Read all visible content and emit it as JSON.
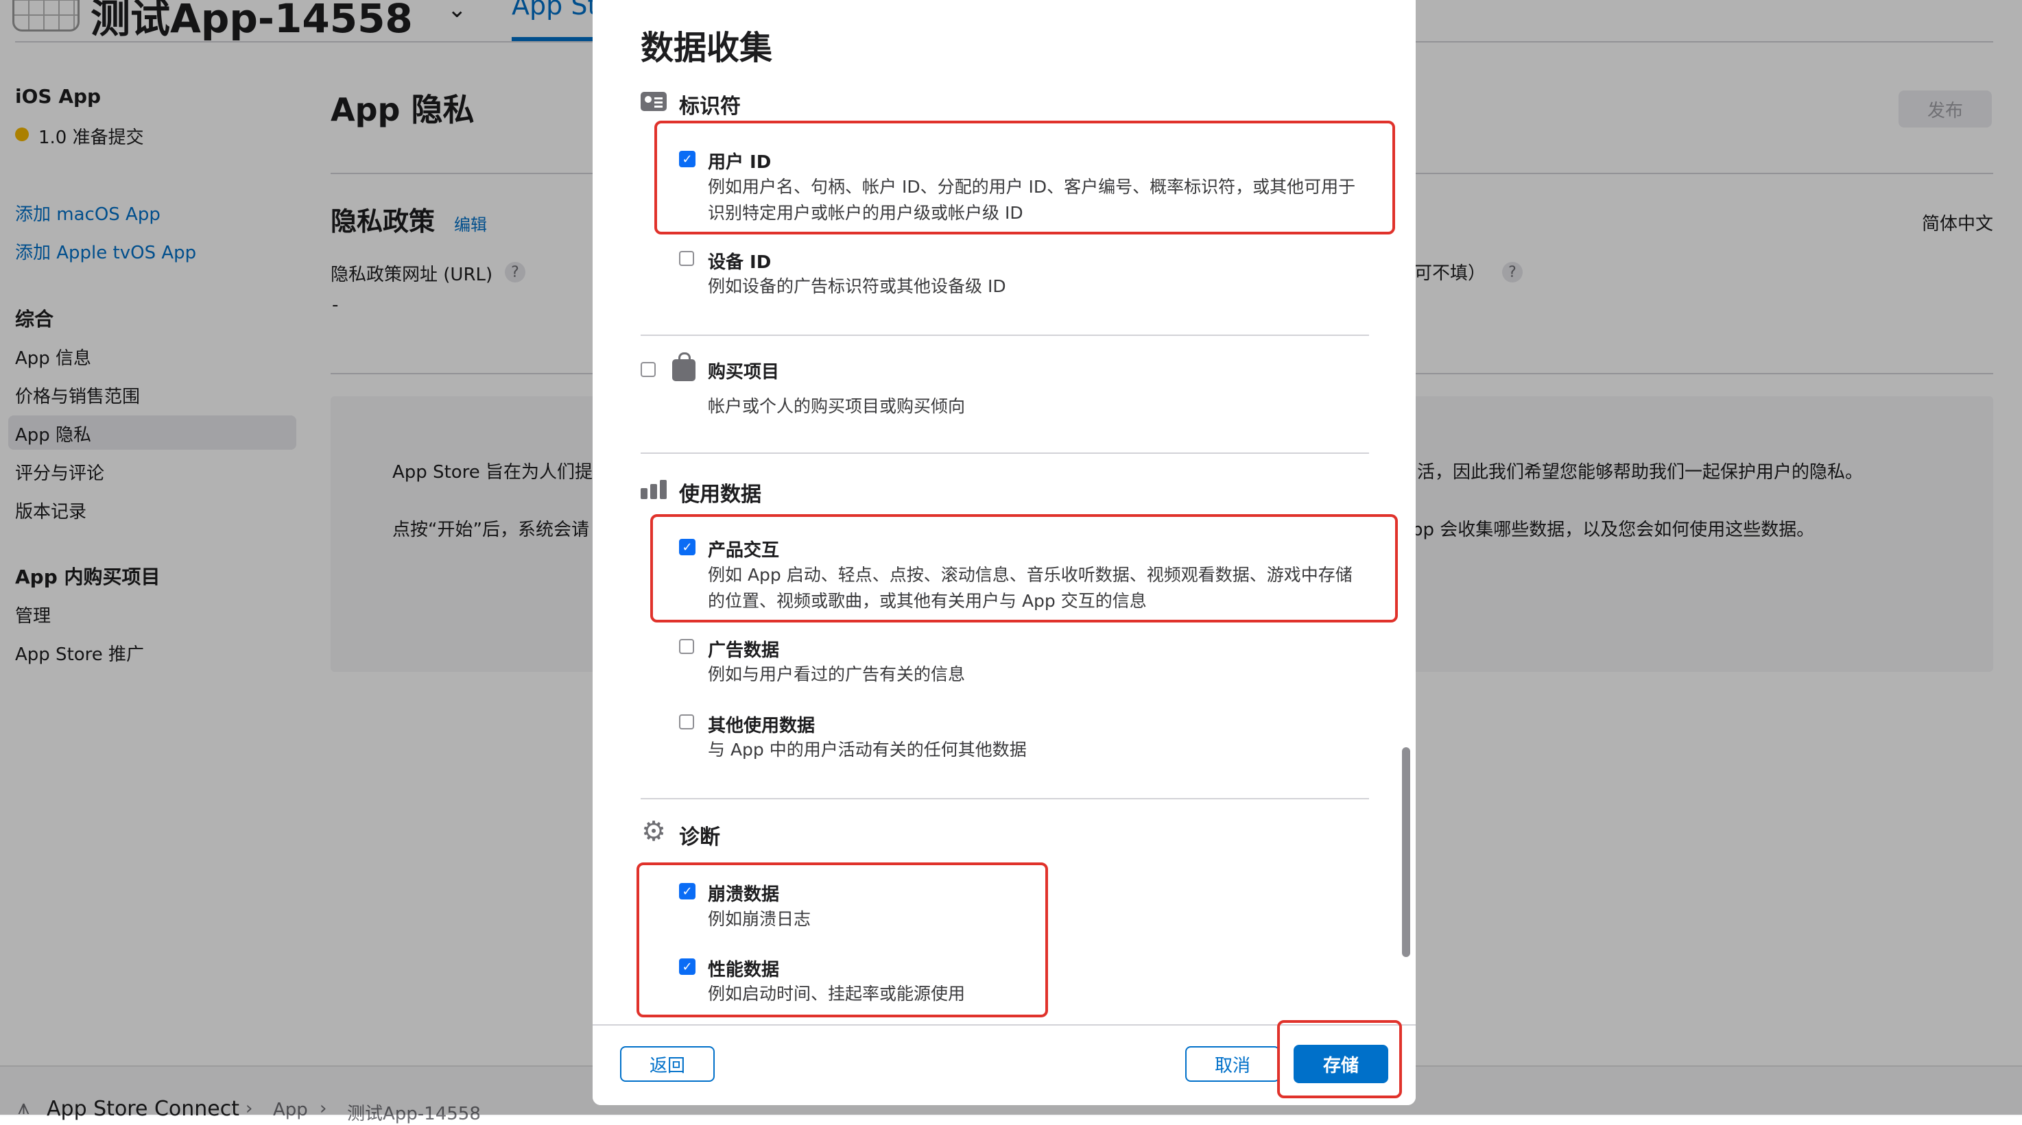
{
  "background": {
    "app_name": "测试App-14558",
    "active_tab": "App St",
    "sidebar": {
      "platform": "iOS App",
      "version_status": "1.0 准备提交",
      "add_links": [
        "添加 macOS App",
        "添加 Apple tvOS App"
      ],
      "general_heading": "综合",
      "general_items": [
        "App 信息",
        "价格与销售范围",
        "App 隐私",
        "评分与评论",
        "版本记录"
      ],
      "iap_heading": "App 内购买项目",
      "iap_items": [
        "管理",
        "App Store 推广"
      ]
    },
    "main": {
      "title": "App 隐私",
      "publish_button": "发布",
      "privacy_policy_title": "隐私政策",
      "edit_link": "编辑",
      "language": "简体中文",
      "url_label": "隐私政策网址 (URL)",
      "url_value": "-",
      "optional_hint": "可不填）",
      "para1_left": "App Store 旨在为人们提",
      "para1_right": "活，因此我们希望您能够帮助我们一起保护用户的隐私。",
      "para2_left": "点按“开始”后，系统会请",
      "para2_right": "pp 会收集哪些数据，以及您会如何使用这些数据。"
    },
    "footer": {
      "brand": "App Store Connect",
      "crumb1": "App",
      "crumb2": "测试App-14558",
      "separator": "›"
    }
  },
  "modal": {
    "title": "数据收集",
    "categories": {
      "identifiers": {
        "title": "标识符",
        "items": [
          {
            "label": "用户 ID",
            "desc": "例如用户名、句柄、帐户 ID、分配的用户 ID、客户编号、概率标识符，或其他可用于识别特定用户或帐户的用户级或帐户级 ID",
            "checked": true
          },
          {
            "label": "设备 ID",
            "desc": "例如设备的广告标识符或其他设备级 ID",
            "checked": false
          }
        ]
      },
      "purchases": {
        "label": "购买项目",
        "desc": "帐户或个人的购买项目或购买倾向",
        "checked": false
      },
      "usage": {
        "title": "使用数据",
        "items": [
          {
            "label": "产品交互",
            "desc": "例如 App 启动、轻点、点按、滚动信息、音乐收听数据、视频观看数据、游戏中存储的位置、视频或歌曲，或其他有关用户与 App 交互的信息",
            "checked": true
          },
          {
            "label": "广告数据",
            "desc": "例如与用户看过的广告有关的信息",
            "checked": false
          },
          {
            "label": "其他使用数据",
            "desc": "与 App 中的用户活动有关的任何其他数据",
            "checked": false
          }
        ]
      },
      "diagnostics": {
        "title": "诊断",
        "items": [
          {
            "label": "崩溃数据",
            "desc": "例如崩溃日志",
            "checked": true
          },
          {
            "label": "性能数据",
            "desc": "例如启动时间、挂起率或能源使用",
            "checked": true
          }
        ]
      }
    },
    "buttons": {
      "back": "返回",
      "cancel": "取消",
      "save": "存储"
    },
    "checkmark": "✓"
  },
  "colors": {
    "accent": "#0070c9",
    "checkbox": "#0a6cf5",
    "highlight": "#e0322b",
    "status": "#f5b800"
  }
}
